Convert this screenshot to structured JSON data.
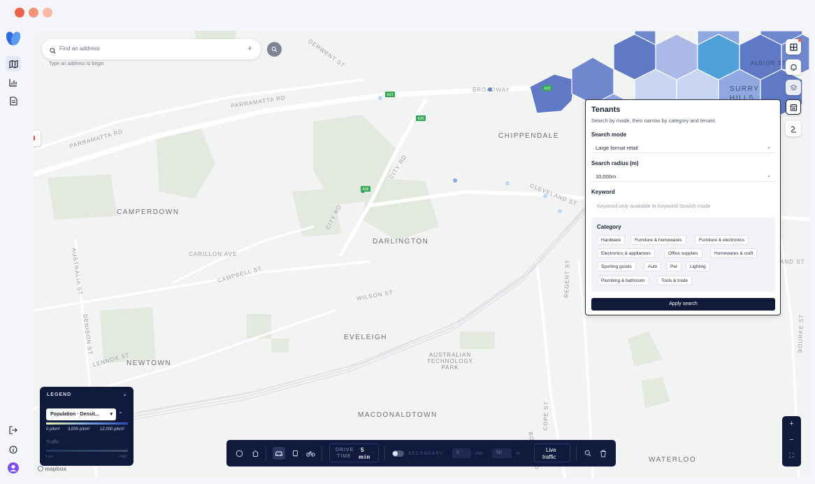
{
  "search": {
    "placeholder": "Find an address",
    "hint": "Type an address to begin"
  },
  "map_labels": {
    "suburbs": [
      "CAMPERDOWN",
      "DARLINGTON",
      "CHIPPENDALE",
      "EVELEIGH",
      "NEWTOWN",
      "MACDONALDTOWN",
      "WATERLOO",
      "SURRY",
      "HILLS"
    ],
    "poi": [
      "AUSTRALIAN",
      "TECHNOLOGY",
      "PARK"
    ],
    "streets": [
      "PARRAMATTA RD",
      "PARRAMATTA RD",
      "DERWENT ST",
      "BROADWAY",
      "CITY RD",
      "CITY RD",
      "CLEVELAND ST",
      "CARILLON AVE",
      "CAMPBELL ST",
      "WILSON ST",
      "REGENT ST",
      "AUSTRALIA ST",
      "DENISON ST",
      "LENNOX ST",
      "COPE ST",
      "BOTANY RD",
      "BOURKE ST",
      "ALBION ST",
      "AND ST"
    ],
    "route_shields": [
      "A22",
      "A36",
      "A36",
      "A22"
    ]
  },
  "tenants": {
    "title": "Tenants",
    "subtitle": "Search by mode, then narrow by category and tenant.",
    "search_mode_label": "Search mode",
    "search_mode_value": "Large format retail",
    "radius_label": "Search radius (m)",
    "radius_value": "10,000m",
    "keyword_label": "Keyword",
    "keyword_placeholder": "Keyword only available in Keyword Search mode",
    "category_label": "Category",
    "categories": [
      "Hardware",
      "Furniture & homewares",
      "Furniture & electronics",
      "Electronics & appliances",
      "Office supplies",
      "Homewares & craft",
      "Sporting goods",
      "Auto",
      "Pet",
      "Lighting",
      "Plumbing & bathroom",
      "Tools & trade"
    ],
    "apply_label": "Apply search"
  },
  "legend": {
    "title": "LEGEND",
    "layer": "Population · Densit...",
    "scale": [
      "0 p/km²",
      "3,000 p/km²",
      "12,000 p/km²"
    ],
    "traffic_label": "Traffic",
    "low": "Low",
    "high": "High"
  },
  "attribution": "mapbox",
  "toolbar": {
    "drive_label_1": "DRIVE",
    "drive_label_2": "TIME",
    "drive_value_1": "5",
    "drive_value_2": "min",
    "secondary_label": "SECONDARY",
    "secondary_value": "5",
    "secondary_unit": "min",
    "percent_value": "50",
    "percent_unit": "%",
    "traffic_1": "Live",
    "traffic_2": "traffic"
  },
  "zoom": {
    "in": "+",
    "out": "−",
    "fit": "⛶"
  },
  "colors": {
    "navy": "#0f1a3d",
    "hex_dark": "#5f79c4",
    "hex_mid": "#8fa8e0",
    "hex_light": "#c9d6f3",
    "hex_cyan": "#4f9fd8"
  }
}
